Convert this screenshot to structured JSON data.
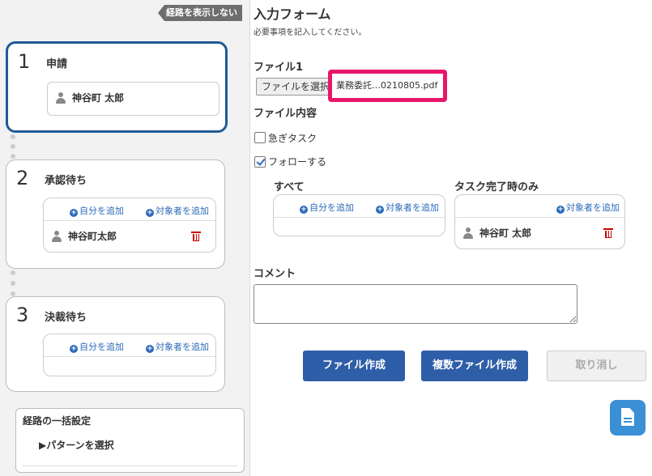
{
  "left": {
    "hide_route": "経路を表示しない",
    "steps": [
      {
        "number": "1",
        "title": "申請",
        "person": "神谷町 太郎"
      },
      {
        "number": "2",
        "title": "承認待ち",
        "add_self": "自分を追加",
        "add_target": "対象者を追加",
        "person": "神谷町太郎"
      },
      {
        "number": "3",
        "title": "決裁待ち",
        "add_self": "自分を追加",
        "add_target": "対象者を追加"
      }
    ],
    "bulk": {
      "title": "経路の一括設定",
      "pattern": "▶パターンを選択"
    }
  },
  "form": {
    "title": "入力フォーム",
    "subtitle": "必要事項を記入してください。",
    "file1_label": "ファイル1",
    "file_button": "ファイルを選択",
    "file_name": "業務委託…0210805.pdf",
    "file_content_label": "ファイル内容",
    "urgent_label": "急ぎタスク",
    "urgent_checked": false,
    "follow_label": "フォローする",
    "follow_checked": true,
    "all": {
      "title": "すべて",
      "add_self": "自分を追加",
      "add_target": "対象者を追加"
    },
    "on_complete": {
      "title": "タスク完了時のみ",
      "add_target": "対象者を追加",
      "person": "神谷町 太郎"
    },
    "comment_label": "コメント",
    "comment_value": "",
    "buttons": {
      "create": "ファイル作成",
      "create_multi": "複数ファイル作成",
      "cancel": "取り消し"
    }
  }
}
